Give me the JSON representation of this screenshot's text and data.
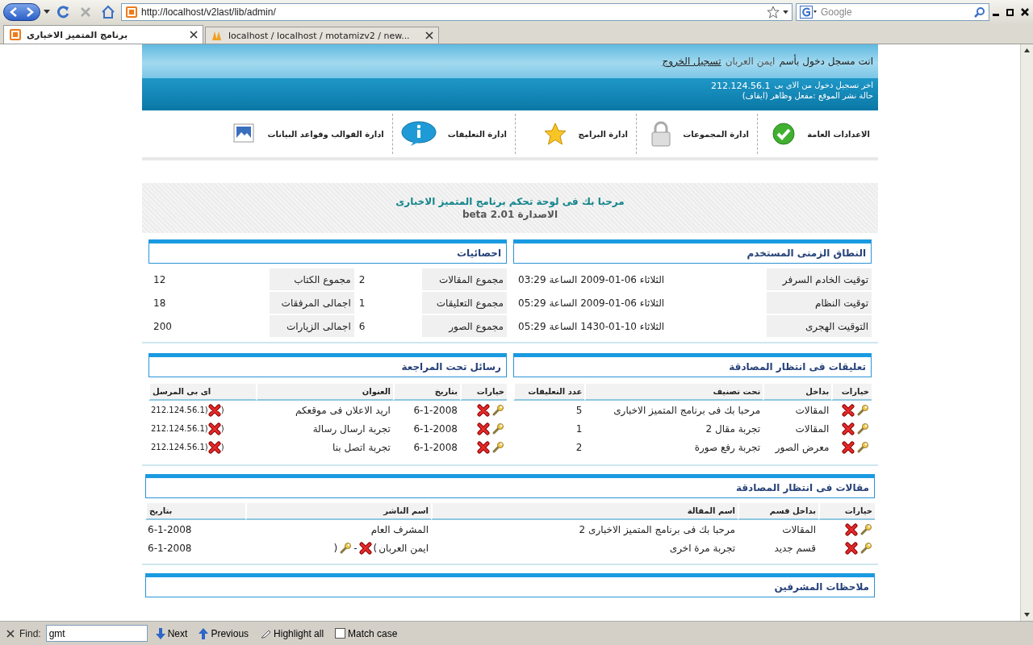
{
  "browser": {
    "url": "http://localhost/v2last/lib/admin/",
    "search_placeholder": "Google",
    "first_tab": {
      "title": "برنامج المتميز الاخبارى",
      "selected": true,
      "kind": "site"
    },
    "second_tab": {
      "title": "localhost / localhost / motamizv2 / new...",
      "selected": false,
      "kind": "pma"
    }
  },
  "header": {
    "login_prefix": "انت مسجل دخول بأسم",
    "user": "ايمن العربان",
    "logout": "تسجيل الخروج",
    "last_login": "اخر تسجيل دخول من الاى بى",
    "last_ip": "212.124.56.1",
    "site_status": "حالة نشر الموقع :مفعل وظاهر (ايقاف)"
  },
  "nav": [
    {
      "label": "الاعدادات العامة",
      "kind": "check"
    },
    {
      "label": "ادارة المجموعات",
      "kind": "lock"
    },
    {
      "label": "ادارة البرامج",
      "kind": "star"
    },
    {
      "label": "ادارة التعليقات",
      "kind": "info"
    },
    {
      "label": "ادارة القوالب وقواعد البيانات",
      "kind": "picture"
    }
  ],
  "welcome": {
    "title": "مرحبا بك فى لوحة تحكم برنامج المتميز الاخبارى",
    "version": "الاصدارة beta 2.01"
  },
  "time_panel": {
    "title": "النطاق الزمنى المستخدم",
    "rows": [
      {
        "label": "توقيت الخادم السرفر",
        "value": "الثلاثاء 06-01-2009 الساعة 03:29"
      },
      {
        "label": "توقيت النظام",
        "value": "الثلاثاء 06-01-2009 الساعة 05:29"
      },
      {
        "label": "التوقيت الهجرى",
        "value": "الثلاثاء 10-01-1430 الساعة 05:29"
      }
    ]
  },
  "stats_panel": {
    "title": "احصائيات",
    "rows": [
      [
        {
          "label": "مجموع المقالات",
          "value": "2"
        },
        {
          "label": "مجموع الكتاب",
          "value": "12"
        }
      ],
      [
        {
          "label": "مجموع التعليقات",
          "value": "1"
        },
        {
          "label": "اجمالى المرفقات",
          "value": "18"
        }
      ],
      [
        {
          "label": "مجموع الصور",
          "value": "6"
        },
        {
          "label": "اجمالى الزيارات",
          "value": "200"
        }
      ]
    ]
  },
  "comments_panel": {
    "title": "تعليقات فى انتظار المصادقة",
    "columns": [
      "خيارات",
      "بداخل",
      "تحت تصنيف",
      "عدد التعليقات"
    ],
    "rows": [
      {
        "section": "المقالات",
        "category": "مرحبا بك فى برنامج المتميز الاخبارى",
        "count": "5"
      },
      {
        "section": "المقالات",
        "category": "تجربة مقال 2",
        "count": "1"
      },
      {
        "section": "معرض الصور",
        "category": "تجربة رفع صورة",
        "count": "2"
      }
    ]
  },
  "messages_panel": {
    "title": "رسائل تحت المراجعة",
    "columns": [
      "خيارات",
      "بتاريخ",
      "العنوان",
      "اى بى المرسل"
    ],
    "rows": [
      {
        "date": "6-1-2008",
        "subject": "اريد الاعلان فى موقعكم",
        "ip": "212.124.56.1",
        "marks": [
          "(",
          "("
        ]
      },
      {
        "date": "6-1-2008",
        "subject": "تجربة ارسال رسالة",
        "ip": "212.124.56.1",
        "marks": [
          "(",
          "("
        ]
      },
      {
        "date": "6-1-2008",
        "subject": "تجربة اتصل بنا",
        "ip": "212.124.56.1",
        "marks": [
          "(",
          "("
        ]
      }
    ]
  },
  "articles_panel": {
    "title": "مقالات فى انتظار المصادقة",
    "columns": [
      "خيارات",
      "بداخل  قسم",
      "اسم المقالة",
      "اسم الناشر",
      "بتاريخ"
    ],
    "rows": [
      {
        "section": "المقالات",
        "title": "مرحبا بك فى برنامج المتميز الاخبارى 2",
        "publisher": "المشرف العام",
        "date": "6-1-2008"
      },
      {
        "section": "قسم جديد",
        "title": "تجربة مرة اخرى",
        "publisher": "ايمن العربان",
        "publisher_marks": [
          ")",
          "-",
          "("
        ],
        "date": "6-1-2008"
      }
    ]
  },
  "notes_panel": {
    "title": "ملاحظات المشرفين"
  },
  "find_bar": {
    "label": "Find:",
    "value": "gmt",
    "next": "Next",
    "previous": "Previous",
    "highlight": "Highlight all",
    "match_case": {
      "label": "Match case",
      "checked": false
    }
  }
}
